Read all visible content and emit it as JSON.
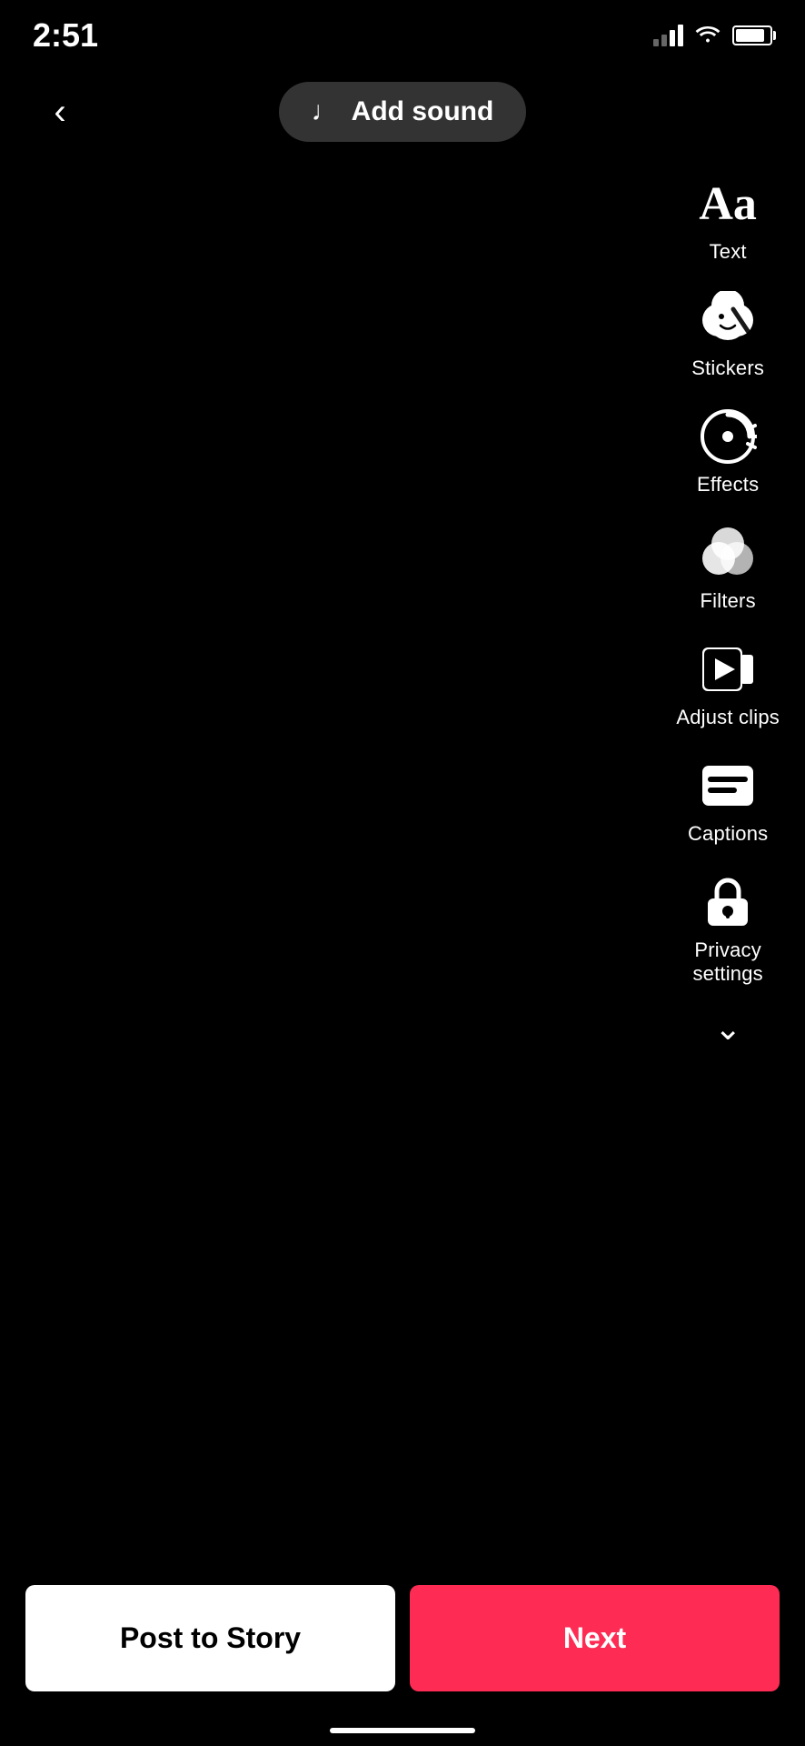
{
  "statusBar": {
    "time": "2:51",
    "signal": "2-bars",
    "wifi": true,
    "battery": 85
  },
  "toolbar": {
    "backLabel": "‹",
    "addSoundLabel": "Add sound",
    "musicNote": "♪"
  },
  "tools": [
    {
      "id": "text",
      "label": "Text",
      "iconType": "text"
    },
    {
      "id": "stickers",
      "label": "Stickers",
      "iconType": "stickers"
    },
    {
      "id": "effects",
      "label": "Effects",
      "iconType": "effects"
    },
    {
      "id": "filters",
      "label": "Filters",
      "iconType": "filters"
    },
    {
      "id": "adjust-clips",
      "label": "Adjust clips",
      "iconType": "adjust"
    },
    {
      "id": "captions",
      "label": "Captions",
      "iconType": "captions"
    },
    {
      "id": "privacy",
      "label": "Privacy\nsettings",
      "iconType": "privacy"
    }
  ],
  "chevronDown": "∨",
  "bottomButtons": {
    "postStoryLabel": "Post to Story",
    "nextLabel": "Next"
  }
}
